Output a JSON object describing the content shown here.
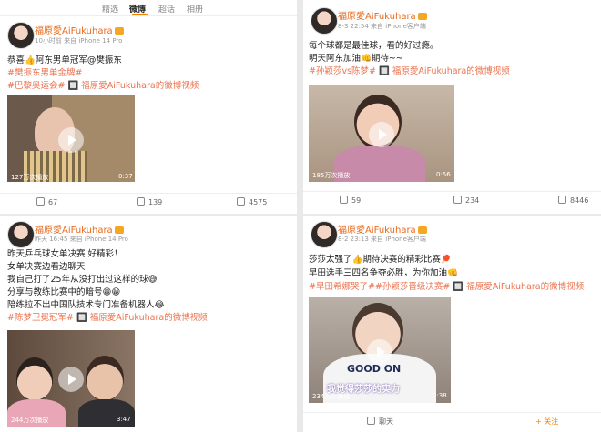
{
  "tabs": [
    "精选",
    "微博",
    "超话",
    "相册"
  ],
  "posts": [
    {
      "user": "福原愛AiFukuhara",
      "meta": "10小时前 来自 iPhone 14 Pro",
      "lines": [
        "恭喜👍阿东男单冠军@樊振东",
        "#樊振东男单金牌#",
        "#巴黎奥运会# 🔲 福原愛AiFukuhara的微博视频"
      ],
      "views": "127万次播放",
      "duration": "0:37",
      "actions": [
        "67",
        "139",
        "4575"
      ]
    },
    {
      "user": "福原愛AiFukuhara",
      "meta": "8-3 22:54 来自 iPhone客户端",
      "lines": [
        "每个球都是最佳球，看的好过瘾。",
        "明天阿东加油👊期待~~",
        "#孙颖莎vs陈梦# 🔲 福原愛AiFukuhara的微博视频"
      ],
      "views": "185万次播放",
      "duration": "0:56",
      "actions": [
        "59",
        "234",
        "8446"
      ]
    },
    {
      "user": "福原愛AiFukuhara",
      "meta": "昨天 16:45 来自 iPhone 14 Pro",
      "lines": [
        "昨天乒乓球女单决赛 好精彩！",
        "女单决赛边看边聊天",
        "我自己打了25年从没打出过这样的球😅",
        "分享与教练比赛中的暗号😁😁",
        "陪练拉不出中国队技术专门准备机器人😂",
        "#陈梦卫冕冠军# 🔲 福原愛AiFukuhara的微博视频"
      ],
      "views": "244万次播放",
      "duration": "3:47"
    },
    {
      "user": "福原愛AiFukuhara",
      "meta": "8-2 23:13 来自 iPhone客户端",
      "lines": [
        "莎莎太强了👍期待决赛的精彩比赛🏓",
        "早田选手三四名争夺必胜，为你加油👊",
        "#早田希娜哭了##孙颖莎晋级决赛# 🔲 福原愛AiFukuhara的微博视频"
      ],
      "views": "234万次播放",
      "duration": "0:38",
      "video_text": "我觉得莎莎的实力",
      "shirt_text": "GOOD ON",
      "actions": [
        "聊天",
        "+ 关注"
      ]
    }
  ]
}
